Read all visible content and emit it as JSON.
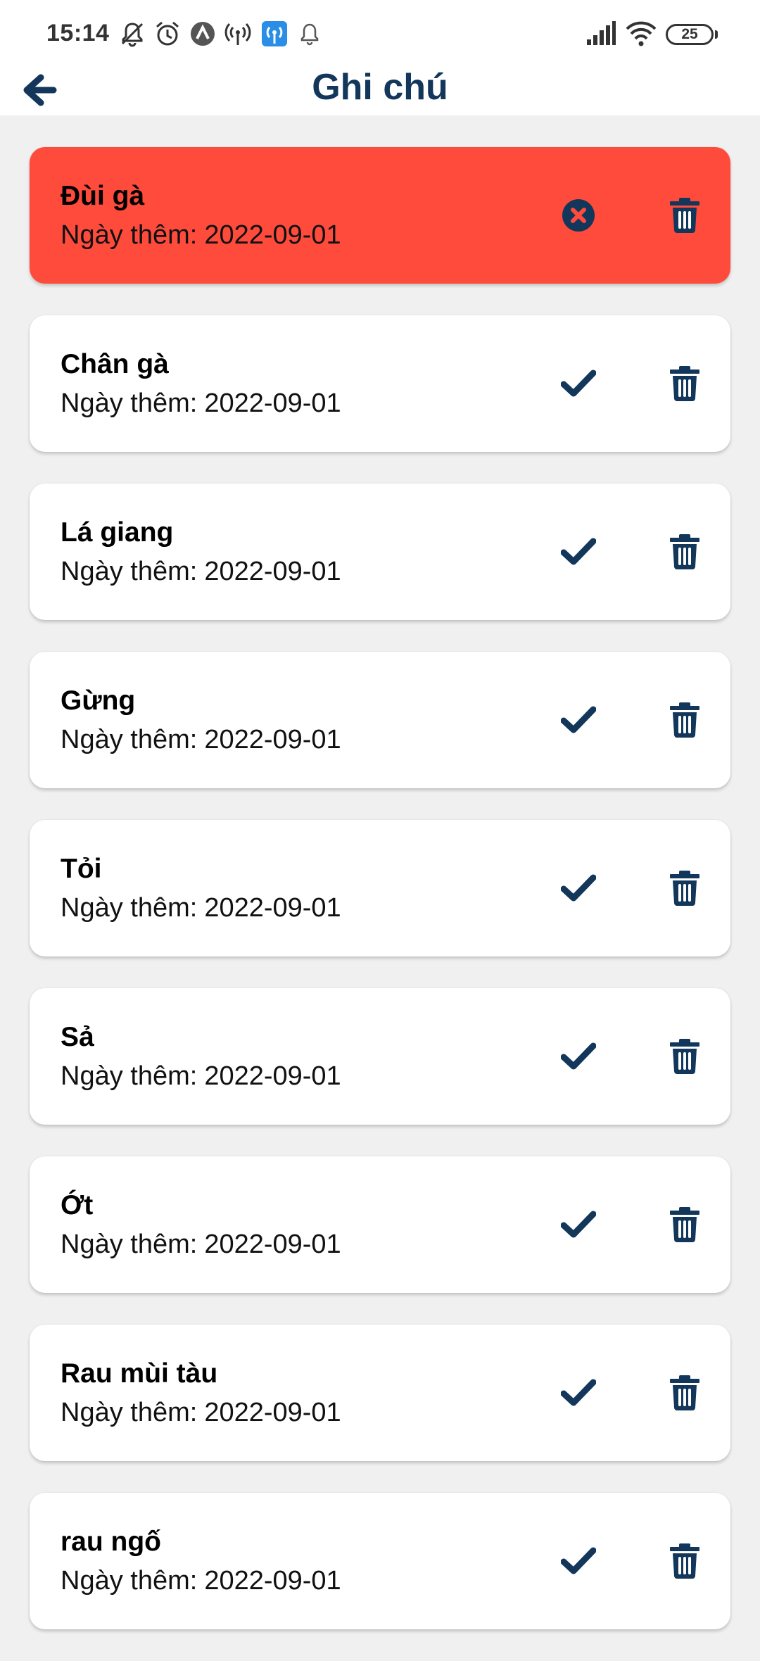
{
  "status_bar": {
    "time": "15:14",
    "battery": "25",
    "icons_left": [
      "mute-icon",
      "alarm-icon",
      "nav-icon",
      "hotspot-icon",
      "wifi-calling-icon",
      "bell-icon"
    ],
    "icons_right": [
      "signal-icon",
      "wifi-icon",
      "battery-icon"
    ]
  },
  "header": {
    "title": "Ghi chú",
    "back_icon": "arrow-left-icon"
  },
  "date_label": "Ngày thêm:",
  "colors": {
    "primary": "#12375a",
    "active_card": "#ff4b3c",
    "background": "#f0f0f0"
  },
  "items": [
    {
      "name": "Đùi gà",
      "date": "2022-09-01",
      "status": "bought",
      "status_icon": "close-circle-icon"
    },
    {
      "name": "Chân gà",
      "date": "2022-09-01",
      "status": "pending",
      "status_icon": "check-icon"
    },
    {
      "name": "Lá giang",
      "date": "2022-09-01",
      "status": "pending",
      "status_icon": "check-icon"
    },
    {
      "name": "Gừng",
      "date": "2022-09-01",
      "status": "pending",
      "status_icon": "check-icon"
    },
    {
      "name": "Tỏi",
      "date": "2022-09-01",
      "status": "pending",
      "status_icon": "check-icon"
    },
    {
      "name": "Sả",
      "date": "2022-09-01",
      "status": "pending",
      "status_icon": "check-icon"
    },
    {
      "name": "Ớt",
      "date": "2022-09-01",
      "status": "pending",
      "status_icon": "check-icon"
    },
    {
      "name": "Rau mùi tàu",
      "date": "2022-09-01",
      "status": "pending",
      "status_icon": "check-icon"
    },
    {
      "name": "rau ngố",
      "date": "2022-09-01",
      "status": "pending",
      "status_icon": "check-icon"
    }
  ]
}
